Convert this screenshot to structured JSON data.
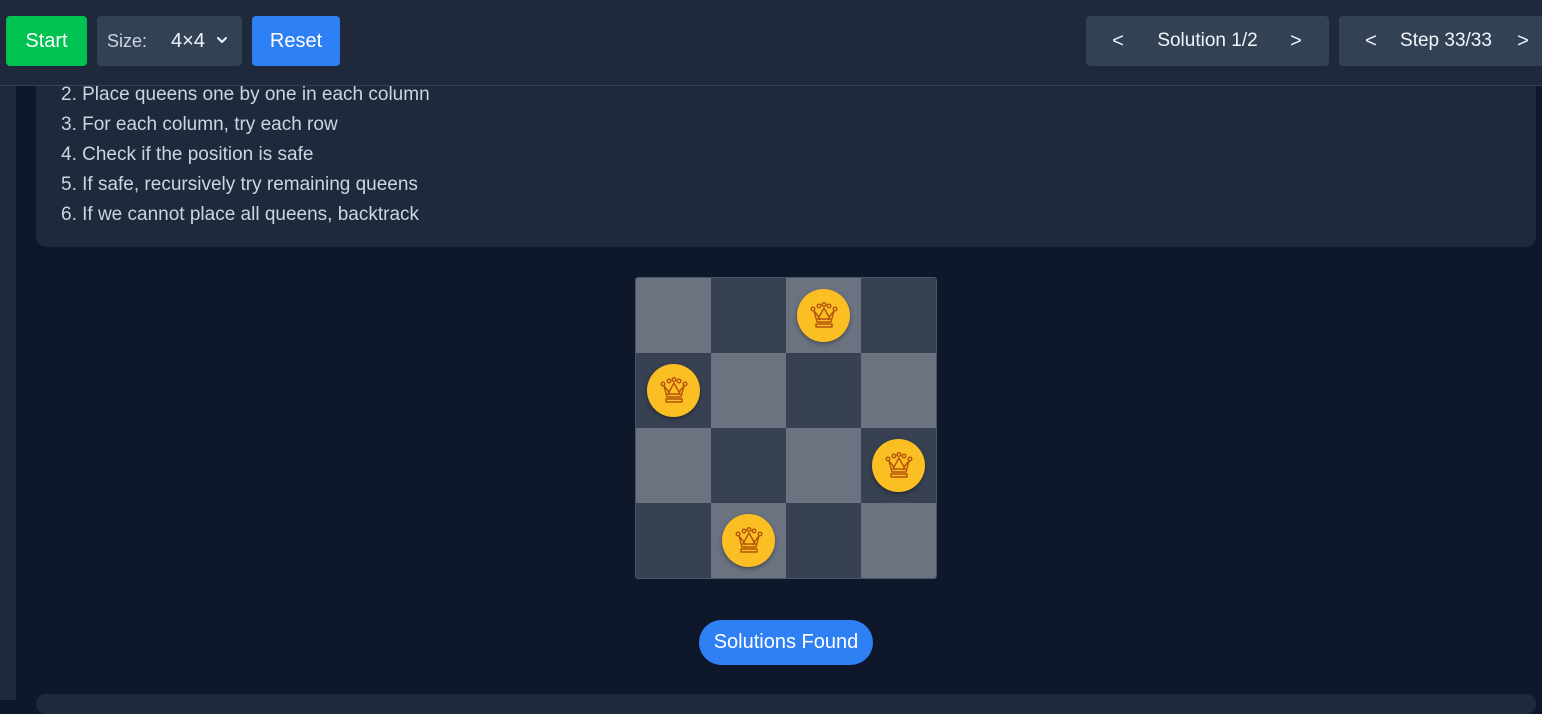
{
  "toolbar": {
    "start_label": "Start",
    "size_label": "Size:",
    "size_value": "4×4",
    "reset_label": "Reset",
    "solution_prev": "<",
    "solution_text": "Solution 1/2",
    "solution_next": ">",
    "step_prev": "<",
    "step_text": "Step 33/33",
    "step_next": ">"
  },
  "explanation": {
    "steps": [
      "2. Place queens one by one in each column",
      "3. For each column, try each row",
      "4. Check if the position is safe",
      "5. If safe, recursively try remaining queens",
      "6. If we cannot place all queens, backtrack"
    ]
  },
  "board": {
    "size": 4,
    "queens": [
      {
        "row": 0,
        "col": 2
      },
      {
        "row": 1,
        "col": 0
      },
      {
        "row": 2,
        "col": 3
      },
      {
        "row": 3,
        "col": 1
      }
    ],
    "queen_icon": "crown-icon"
  },
  "status": {
    "label": "Solutions Found"
  },
  "colors": {
    "start": "#00c250",
    "reset": "#2f7ff5",
    "queen": "#fbbf24",
    "light_square": "#6b7280",
    "dark_square": "#374151",
    "background": "#0f172a",
    "panel": "#1e293b"
  }
}
